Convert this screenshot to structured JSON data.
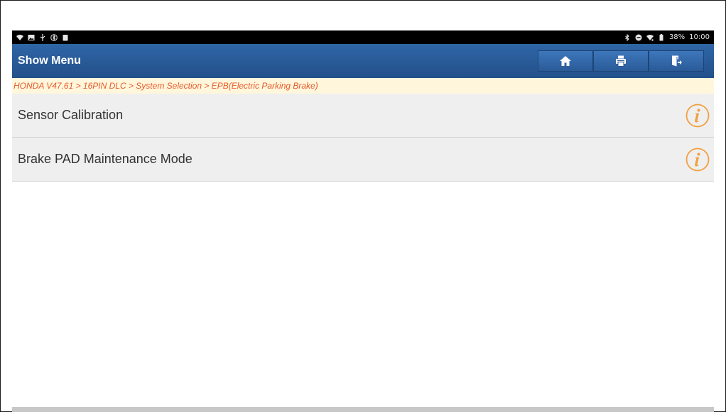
{
  "status_bar": {
    "left_icons": [
      "wifi-icon",
      "image-icon",
      "usb-icon",
      "bluetooth-circle-icon",
      "lock-icon"
    ],
    "right_icons": [
      "bluetooth-icon",
      "minus-circle-icon",
      "wifi-signal-icon",
      "battery-icon"
    ],
    "battery": "38%",
    "time": "10:00"
  },
  "header": {
    "title": "Show Menu",
    "buttons": [
      {
        "name": "home",
        "icon": "home-icon"
      },
      {
        "name": "print",
        "icon": "print-icon"
      },
      {
        "name": "exit",
        "icon": "exit-icon"
      }
    ]
  },
  "breadcrumb": {
    "text": "HONDA V47.61 > 16PIN DLC > System Selection > EPB(Electric Parking Brake)"
  },
  "menu": {
    "items": [
      {
        "label": "Sensor Calibration",
        "icon": "info-icon"
      },
      {
        "label": "Brake PAD Maintenance Mode",
        "icon": "info-icon"
      }
    ]
  },
  "colors": {
    "title_bar": "#2a5a98",
    "breadcrumb_text": "#e85a2a",
    "info_icon": "#f0a040"
  }
}
